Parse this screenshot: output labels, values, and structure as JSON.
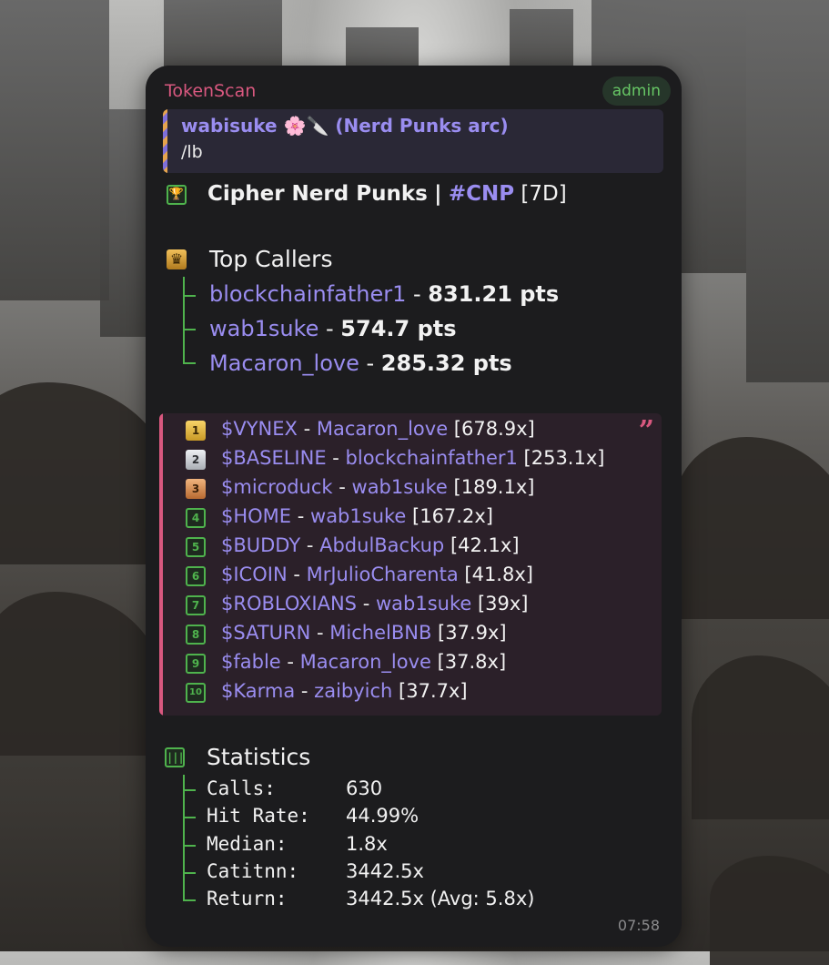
{
  "message": {
    "sender": "TokenScan",
    "badge": "admin",
    "time": "07:58"
  },
  "reply": {
    "name": "wabisuke 🌸🔪 (Nerd Punks arc)",
    "command": "/lb"
  },
  "header": {
    "title": "Cipher Nerd Punks",
    "separator": "|",
    "tag": "#CNP",
    "period": "[7D]"
  },
  "top_callers": {
    "heading": "Top Callers",
    "items": [
      {
        "user": "blockchainfather1",
        "sep": " - ",
        "points": "831.21 pts"
      },
      {
        "user": "wab1suke",
        "sep": " - ",
        "points": "574.7 pts"
      },
      {
        "user": "Macaron_love",
        "sep": " - ",
        "points": "285.32 pts"
      }
    ]
  },
  "leaderboard": {
    "quote_mark": "”",
    "rows": [
      {
        "rank": "1",
        "token": "$VYNEX",
        "dash": " - ",
        "caller": "Macaron_love",
        "multiple": " [678.9x]"
      },
      {
        "rank": "2",
        "token": "$BASELINE",
        "dash": " - ",
        "caller": "blockchainfather1",
        "multiple": " [253.1x]"
      },
      {
        "rank": "3",
        "token": "$microduck",
        "dash": " - ",
        "caller": "wab1suke",
        "multiple": " [189.1x]"
      },
      {
        "rank": "4",
        "token": "$HOME",
        "dash": " - ",
        "caller": "wab1suke",
        "multiple": " [167.2x]"
      },
      {
        "rank": "5",
        "token": "$BUDDY",
        "dash": " - ",
        "caller": "AbdulBackup",
        "multiple": " [42.1x]"
      },
      {
        "rank": "6",
        "token": "$ICOIN",
        "dash": " - ",
        "caller": "MrJulioCharenta",
        "multiple": " [41.8x]"
      },
      {
        "rank": "7",
        "token": "$ROBLOXIANS",
        "dash": " - ",
        "caller": "wab1suke",
        "multiple": " [39x]"
      },
      {
        "rank": "8",
        "token": "$SATURN",
        "dash": " - ",
        "caller": "MichelBNB",
        "multiple": " [37.9x]"
      },
      {
        "rank": "9",
        "token": "$fable",
        "dash": " - ",
        "caller": "Macaron_love",
        "multiple": " [37.8x]"
      },
      {
        "rank": "10",
        "token": "$Karma",
        "dash": " - ",
        "caller": "zaibyich",
        "multiple": " [37.7x]"
      }
    ]
  },
  "statistics": {
    "heading": "Statistics",
    "items": [
      {
        "label": "Calls:",
        "value": "630"
      },
      {
        "label": "Hit Rate:",
        "value": "44.99%"
      },
      {
        "label": "Median:",
        "value": "1.8x"
      },
      {
        "label": "Catitnn:",
        "value": "3442.5x"
      },
      {
        "label": "Return:",
        "value": "3442.5x (Avg: 5.8x)"
      }
    ]
  },
  "icons": {
    "title_icon": "trophy-icon",
    "callers_icon": "crown-icon",
    "stats_icon": "bar-chart-icon"
  },
  "colors": {
    "sender": "#d9587f",
    "accent": "#9a8df0",
    "tree": "#4fb34d",
    "card": "#1c1c1e"
  }
}
